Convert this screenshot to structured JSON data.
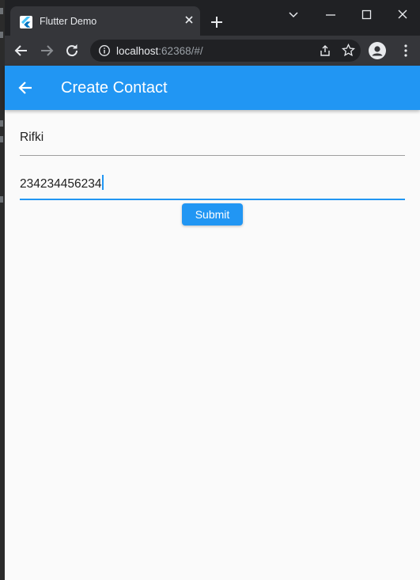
{
  "browser": {
    "tab_title": "Flutter Demo",
    "url_host": "localhost",
    "url_rest": ":62368/#/"
  },
  "app": {
    "title": "Create Contact",
    "name_value": "Rifki",
    "phone_value": "234234456234",
    "submit_label": "Submit"
  },
  "colors": {
    "primary": "#2196f3",
    "page_background": "#fafafa",
    "chrome_dark": "#202124",
    "chrome_toolbar": "#35363a"
  },
  "icons": [
    "flutter-favicon-icon",
    "close-icon",
    "plus-icon",
    "chevron-down-icon",
    "minimize-icon",
    "maximize-icon",
    "window-close-icon",
    "back-arrow-icon",
    "forward-arrow-icon",
    "reload-icon",
    "info-icon",
    "share-icon",
    "star-icon",
    "profile-icon",
    "menu-icon",
    "appbar-back-arrow-icon"
  ]
}
